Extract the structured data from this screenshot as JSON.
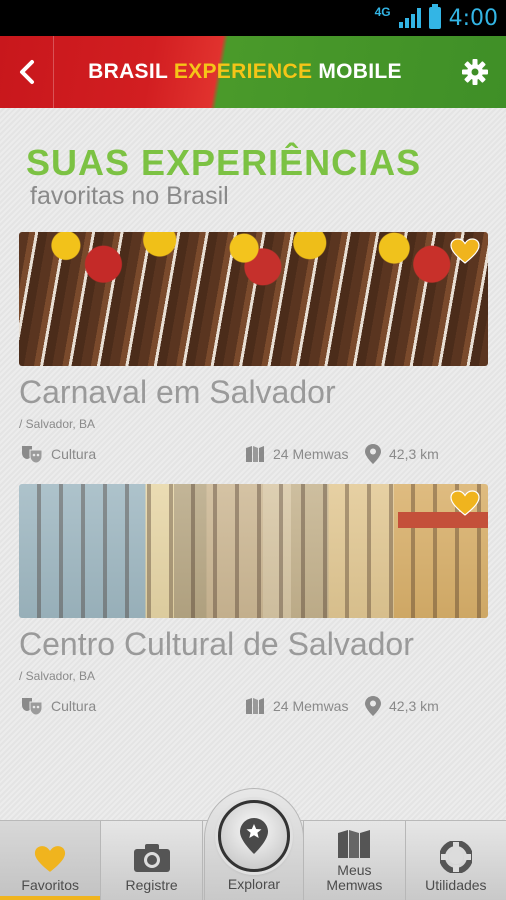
{
  "status_bar": {
    "network": "4G",
    "time": "4:00"
  },
  "header": {
    "title_part1": "BRASIL ",
    "title_accent": "EXPERIENCE",
    "title_part2": " MOBILE",
    "accent_color": "#f5c518"
  },
  "page": {
    "title": "SUAS EXPERIÊNCIAS",
    "subtitle": "favoritas no Brasil"
  },
  "experiences": [
    {
      "title": "Carnaval em Salvador",
      "location": "/ Salvador, BA",
      "category": "Cultura",
      "memwas": "24 Memwas",
      "distance": "42,3 km",
      "favorite": true
    },
    {
      "title": "Centro Cultural de Salvador",
      "location": "/ Salvador, BA",
      "category": "Cultura",
      "memwas": "24 Memwas",
      "distance": "42,3 km",
      "favorite": true
    }
  ],
  "tabs": [
    {
      "label": "Favoritos",
      "icon": "heart-icon",
      "active": true
    },
    {
      "label": "Registre",
      "icon": "camera-icon",
      "active": false
    },
    {
      "label": "Explorar",
      "icon": "map-pin-star-icon",
      "active": false
    },
    {
      "label": "Meus\nMemwas",
      "icon": "memwas-icon",
      "active": false
    },
    {
      "label": "Utilidades",
      "icon": "lifebuoy-icon",
      "active": false
    }
  ],
  "colors": {
    "brand_green": "#7cc243",
    "brand_red": "#c8171c",
    "heart_gold": "#f0b41e",
    "status_blue": "#33b5e5"
  }
}
